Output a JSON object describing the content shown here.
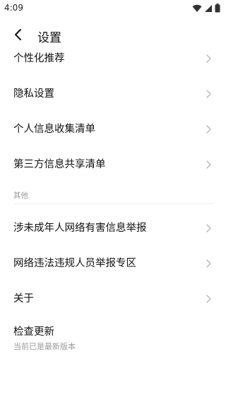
{
  "status_bar": {
    "time": "4:09",
    "icons": [
      "wifi-icon",
      "signal-icon",
      "battery-icon"
    ]
  },
  "header": {
    "back_icon": "chevron-left-icon",
    "title": "设置"
  },
  "settings_items": [
    {
      "label": "个性化推荐",
      "icon": "chevron-right-icon"
    },
    {
      "label": "隐私设置",
      "icon": "chevron-right-icon"
    },
    {
      "label": "个人信息收集清单",
      "icon": "chevron-right-icon"
    },
    {
      "label": "第三方信息共享清单",
      "icon": "chevron-right-icon"
    }
  ],
  "other_section": {
    "title": "其他",
    "items": [
      {
        "label": "涉未成年人网络有害信息举报",
        "icon": "chevron-right-icon"
      },
      {
        "label": "网络违法违规人员举报专区",
        "icon": "chevron-right-icon"
      },
      {
        "label": "关于",
        "icon": "chevron-right-icon"
      }
    ],
    "update": {
      "label": "检查更新",
      "status": "当前已是最新版本"
    }
  },
  "colors": {
    "background": "#ffffff",
    "text_primary": "#111111",
    "text_secondary": "#9a9a9a",
    "chevron": "#b5b5b5",
    "divider": "#eeeeee"
  }
}
